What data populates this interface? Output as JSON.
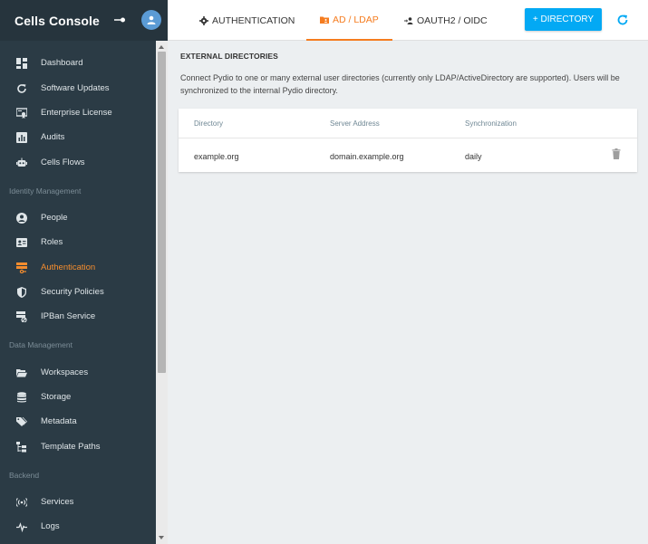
{
  "app": {
    "title": "Cells Console"
  },
  "sidebar": {
    "sections": [
      {
        "title": "",
        "items": [
          {
            "label": "Dashboard",
            "icon": "dashboard-icon"
          },
          {
            "label": "Software Updates",
            "icon": "update-icon"
          },
          {
            "label": "Enterprise License",
            "icon": "license-icon"
          },
          {
            "label": "Audits",
            "icon": "chart-icon"
          },
          {
            "label": "Cells Flows",
            "icon": "robot-icon"
          }
        ]
      },
      {
        "title": "Identity Management",
        "items": [
          {
            "label": "People",
            "icon": "person-icon"
          },
          {
            "label": "Roles",
            "icon": "id-card-icon"
          },
          {
            "label": "Authentication",
            "icon": "server-key-icon",
            "active": true
          },
          {
            "label": "Security Policies",
            "icon": "shield-icon"
          },
          {
            "label": "IPBan Service",
            "icon": "ip-ban-icon"
          }
        ]
      },
      {
        "title": "Data Management",
        "items": [
          {
            "label": "Workspaces",
            "icon": "folder-open-icon"
          },
          {
            "label": "Storage",
            "icon": "database-icon"
          },
          {
            "label": "Metadata",
            "icon": "tags-icon"
          },
          {
            "label": "Template Paths",
            "icon": "file-tree-icon"
          }
        ]
      },
      {
        "title": "Backend",
        "items": [
          {
            "label": "Services",
            "icon": "access-point-icon"
          },
          {
            "label": "Logs",
            "icon": "pulse-icon"
          }
        ]
      }
    ]
  },
  "topbar": {
    "tabs": [
      {
        "label": "AUTHENTICATION",
        "icon": "gear-icon"
      },
      {
        "label": "AD / LDAP",
        "icon": "folder-account-icon",
        "active": true
      },
      {
        "label": "OAUTH2 / OIDC",
        "icon": "account-arrow-icon"
      }
    ],
    "add_button": "+ DIRECTORY",
    "refresh_icon": "refresh-icon"
  },
  "main": {
    "heading": "EXTERNAL DIRECTORIES",
    "legend": "Connect Pydio to one or many external user directories (currently only LDAP/ActiveDirectory are supported). Users will be synchronized to the internal Pydio directory.",
    "table": {
      "columns": [
        "Directory",
        "Server Address",
        "Synchronization"
      ],
      "rows": [
        {
          "directory": "example.org",
          "server": "domain.example.org",
          "sync": "daily"
        }
      ]
    }
  },
  "colors": {
    "sidebar_bg": "#2b3b45",
    "accent": "#f57c1f",
    "primary_button": "#03a9f4"
  }
}
